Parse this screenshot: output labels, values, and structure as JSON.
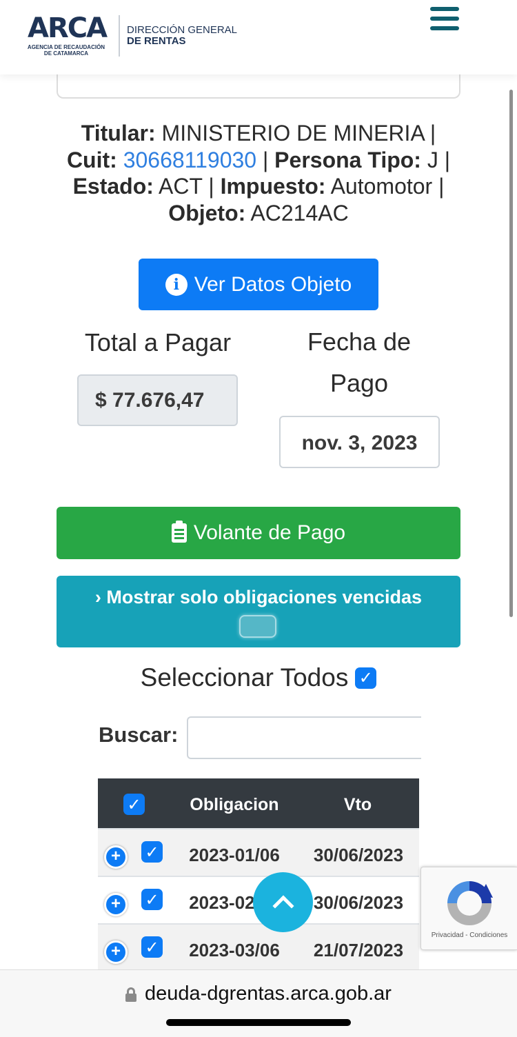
{
  "header": {
    "logo_word": "ARCA",
    "logo_sub": "AGENCIA DE RECAUDACIÓN DE CATAMARCA",
    "org_line1": "DIRECCIÓN GENERAL",
    "org_line2": "DE RENTAS",
    "menu_icon": "hamburger-menu-icon"
  },
  "info": {
    "titular_label": "Titular:",
    "titular_value": "MINISTERIO DE MINERIA",
    "cuit_label": "Cuit:",
    "cuit_value": "30668119030",
    "persona_label": "Persona Tipo:",
    "persona_value": "J",
    "estado_label": "Estado:",
    "estado_value": "ACT",
    "impuesto_label": "Impuesto:",
    "impuesto_value": "Automotor",
    "objeto_label": "Objeto:",
    "objeto_value": "AC214AC",
    "separator": "|"
  },
  "actions": {
    "ver_datos_label": "Ver Datos Objeto",
    "volante_label": "Volante de Pago",
    "mostrar_label": "Mostrar solo obligaciones vencidas"
  },
  "payment": {
    "total_label": "Total a Pagar",
    "total_value": "$ 77.676,47",
    "fecha_label": "Fecha de Pago",
    "fecha_value": "nov. 3, 2023"
  },
  "select_all_label": "Seleccionar Todos",
  "search": {
    "label": "Buscar:",
    "value": ""
  },
  "table": {
    "headers": {
      "obligacion": "Obligacion",
      "vto": "Vto"
    },
    "rows": [
      {
        "obligacion": "2023-01/06",
        "vto": "30/06/2023"
      },
      {
        "obligacion": "2023-02/06",
        "vto": "30/06/2023"
      },
      {
        "obligacion": "2023-03/06",
        "vto": "21/07/2023"
      }
    ]
  },
  "recaptcha": {
    "text": "Privacidad - Condiciones"
  },
  "browser": {
    "url": "deuda-dgrentas.arca.gob.ar"
  },
  "colors": {
    "primary": "#0d7bf5",
    "success": "#28a745",
    "info": "#17a2b8",
    "table_header": "#343a40",
    "link": "#2f7fe0"
  }
}
